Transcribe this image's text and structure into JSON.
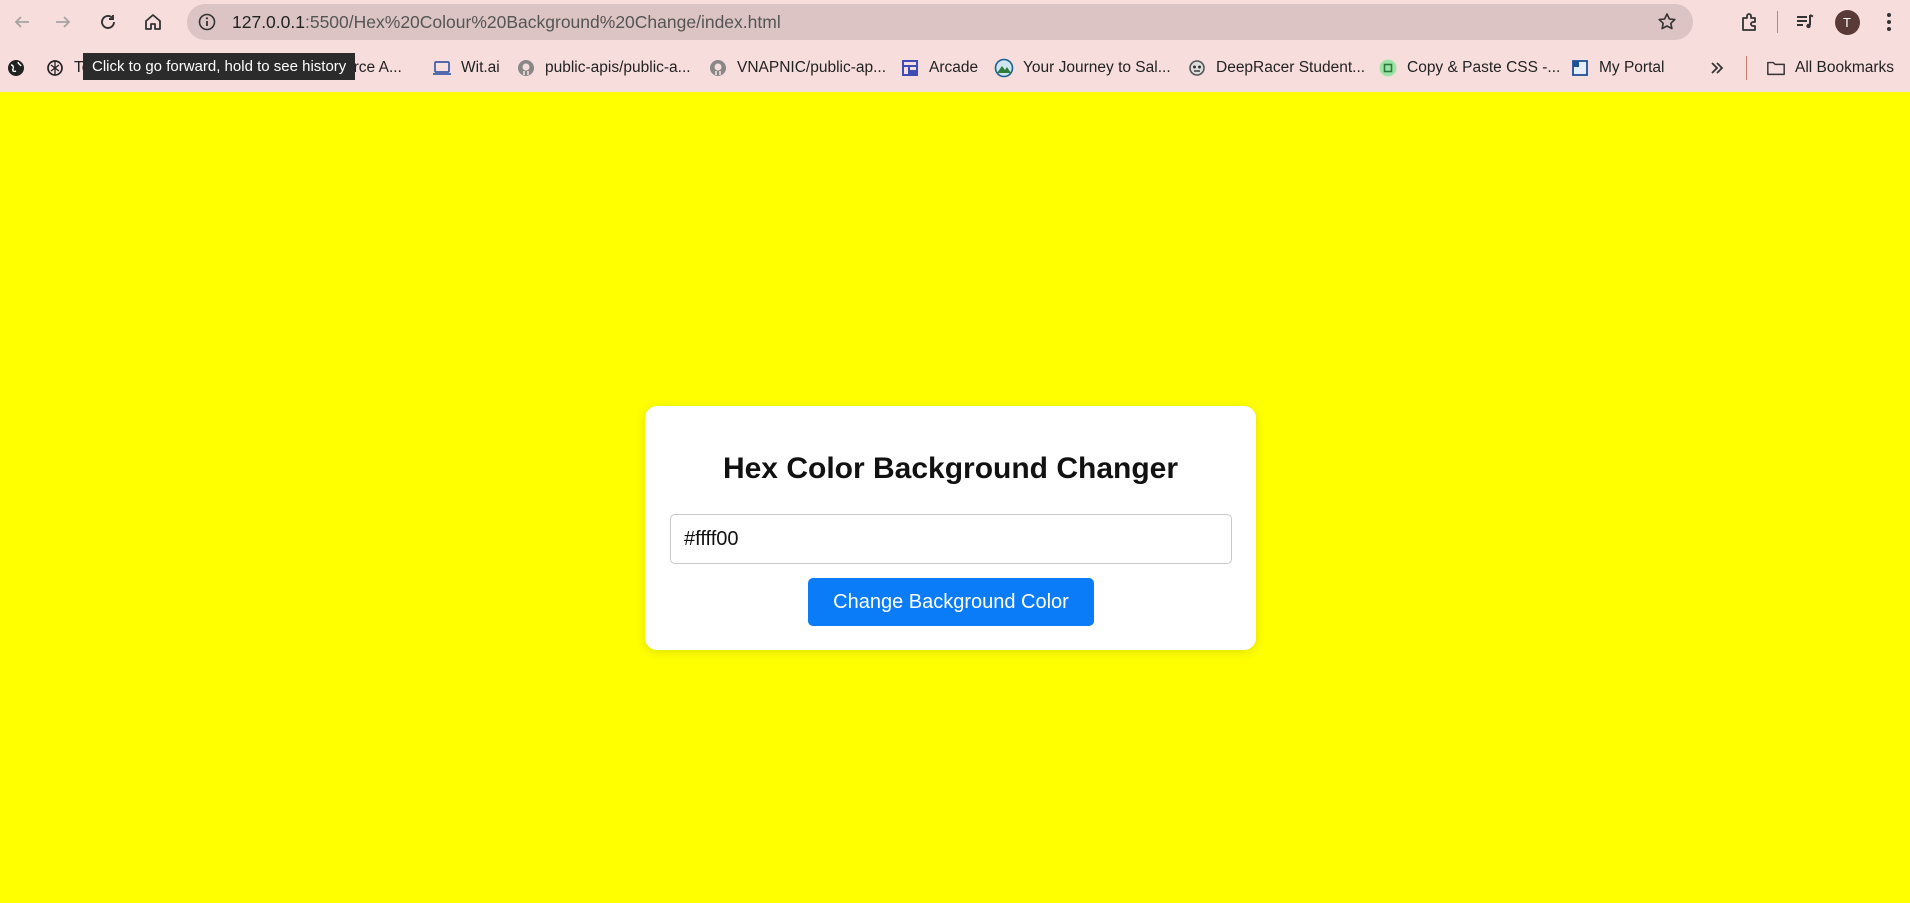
{
  "browser": {
    "url_host": "127.0.0.1",
    "url_rest": ":5500/Hex%20Colour%20Background%20Change/index.html",
    "tooltip": "Click to go forward, hold to see history",
    "avatar_letter": "T"
  },
  "bookmarks": {
    "items": [
      {
        "label": "Te",
        "icon": "openai-icon"
      },
      {
        "label": "urce A...",
        "icon": "bookmark-icon"
      },
      {
        "label": "Wit.ai",
        "icon": "wit-icon"
      },
      {
        "label": "public-apis/public-a...",
        "icon": "github-icon"
      },
      {
        "label": "VNAPNIC/public-ap...",
        "icon": "github-icon"
      },
      {
        "label": "Arcade",
        "icon": "arcade-icon"
      },
      {
        "label": "Your Journey to Sal...",
        "icon": "salesforce-icon"
      },
      {
        "label": "DeepRacer Student...",
        "icon": "deepracer-icon"
      },
      {
        "label": "Copy & Paste CSS -...",
        "icon": "css-icon"
      },
      {
        "label": "My Portal",
        "icon": "portal-icon"
      }
    ],
    "all_bookmarks": "All Bookmarks"
  },
  "page": {
    "background_color": "#ffff00",
    "title": "Hex Color Background Changer",
    "input_value": "#ffff00",
    "button_label": "Change Background Color",
    "button_color": "#0a7cf8"
  }
}
